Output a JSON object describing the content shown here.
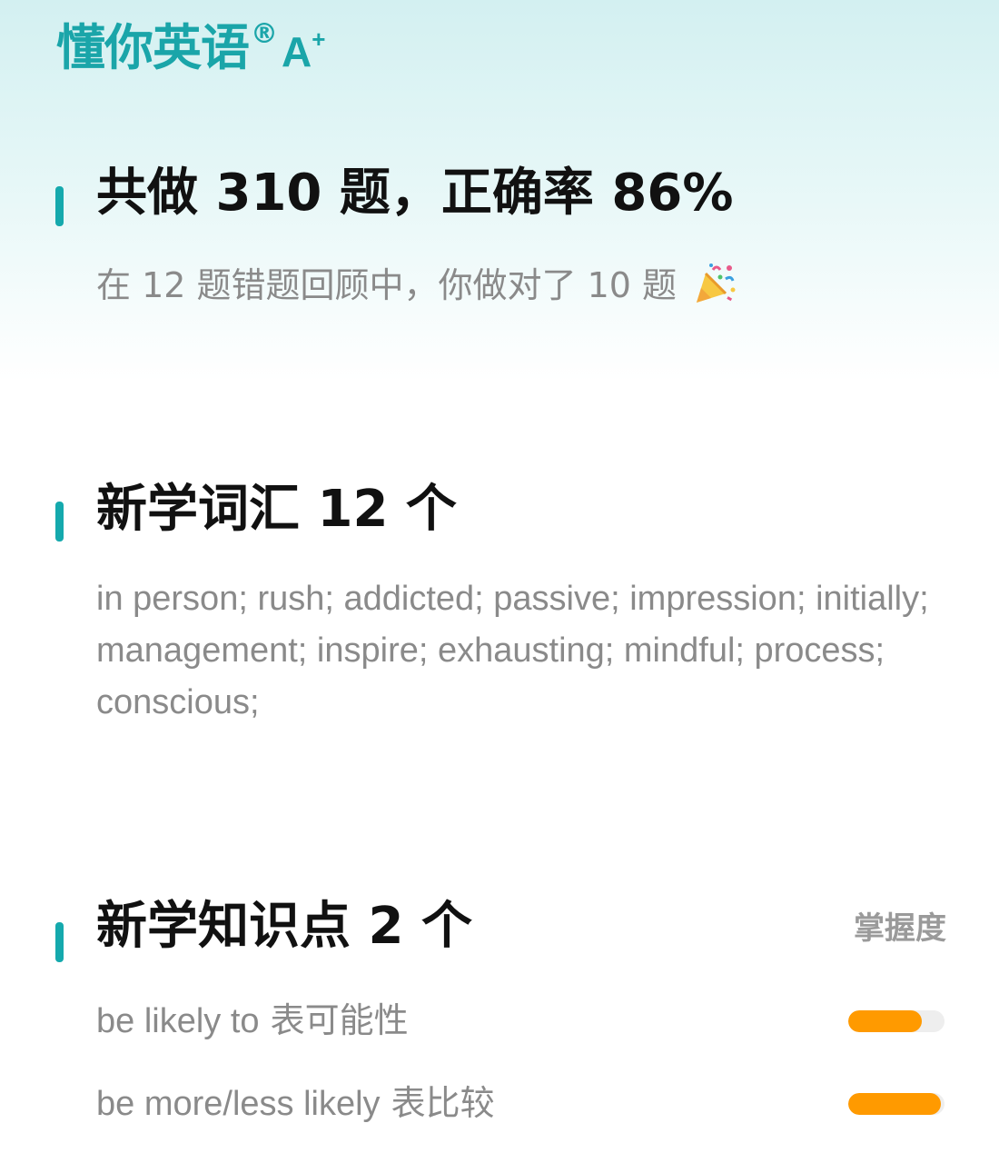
{
  "brand": {
    "name": "懂你英语",
    "reg_mark": "®",
    "grade": "A",
    "grade_plus": "+"
  },
  "summary": {
    "heading": "共做 310 题，正确率 86%",
    "subtext": "在 12 题错题回顾中，你做对了 10 题",
    "icon": "party-popper-icon"
  },
  "vocabulary": {
    "heading": "新学词汇 12 个",
    "words": "in person; rush; addicted; passive; impression; initially; management; inspire; exhausting; mindful; process; conscious;"
  },
  "knowledge": {
    "heading": "新学知识点 2 个",
    "mastery_label": "掌握度",
    "items": [
      {
        "en": "be likely to",
        "zh": "表可能性",
        "mastery_percent": 76
      },
      {
        "en": "be more/less likely",
        "zh": "表比较",
        "mastery_percent": 96
      }
    ]
  },
  "colors": {
    "accent": "#15a9ad",
    "brand": "#1aa5a9",
    "progress": "#ff9a00",
    "progress_track": "#eeeeee"
  }
}
